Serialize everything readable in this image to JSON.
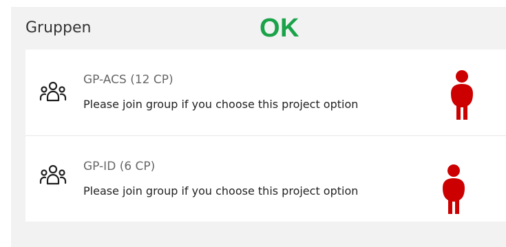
{
  "panel": {
    "title": "Gruppen",
    "status_label": "OK"
  },
  "groups": [
    {
      "name": "GP-ACS (12 CP)",
      "description": "Please join group if you choose this project option",
      "icon": "group-icon",
      "marker": "person-icon"
    },
    {
      "name": "GP-ID (6 CP)",
      "description": "Please join group if you choose this project option",
      "icon": "group-icon",
      "marker": "person-icon"
    }
  ],
  "colors": {
    "status_ok": "#1aa348",
    "marker": "#cc0000",
    "panel_bg": "#f2f2f2",
    "card_bg": "#ffffff"
  }
}
